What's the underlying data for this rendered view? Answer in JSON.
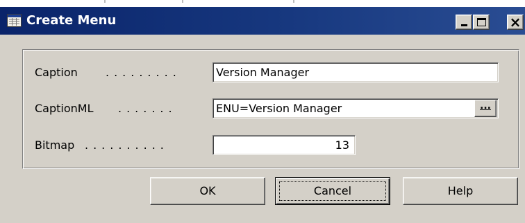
{
  "window": {
    "title": "Create Menu",
    "title_icon": "menu-form-icon",
    "controls": {
      "minimize_icon": "minimize-icon",
      "maximize_icon": "maximize-icon",
      "close_icon": "close-icon",
      "close_glyph": "×"
    }
  },
  "form": {
    "caption": {
      "label": "Caption",
      "dots": ".........",
      "value": "Version Manager"
    },
    "caption_ml": {
      "label": "CaptionML",
      "dots": ".......",
      "value": "ENU=Version Manager",
      "assist_label": "..."
    },
    "bitmap": {
      "label": "Bitmap",
      "dots": "..........",
      "value": "13"
    }
  },
  "buttons": {
    "ok": "OK",
    "cancel": "Cancel",
    "help": "Help"
  }
}
